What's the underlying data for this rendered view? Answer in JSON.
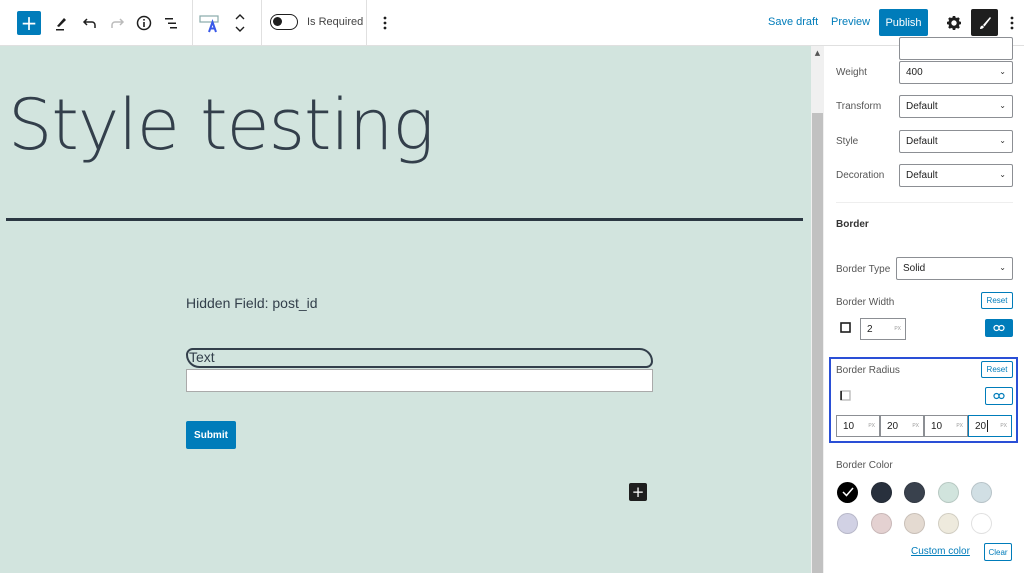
{
  "toolbar": {
    "add_block_icon": "plus-icon",
    "tools_icon": "pencil-icon",
    "undo_icon": "undo-icon",
    "redo_icon": "redo-icon",
    "details_icon": "info-icon",
    "list_view_icon": "list-view-icon",
    "block_type_icon": "text-field-icon",
    "move_icon": "chevron-up-down-icon",
    "required_toggle": {
      "label": "Is Required",
      "checked": false
    },
    "more_icon": "vertical-ellipsis-icon",
    "save_draft_label": "Save draft",
    "preview_label": "Preview",
    "publish_label": "Publish",
    "settings_icon": "gear-icon",
    "styles_icon": "brush-icon",
    "options_icon": "vertical-ellipsis-icon"
  },
  "canvas": {
    "post_title": "Style testing",
    "hidden_field_text": "Hidden Field: post_id",
    "text_field_label": "Text",
    "text_field_value": "",
    "submit_label": "Submit",
    "inserter_icon": "plus-icon"
  },
  "sidebar": {
    "typography": {
      "weight": {
        "label": "Weight",
        "value": "400"
      },
      "transform": {
        "label": "Transform",
        "value": "Default"
      },
      "style": {
        "label": "Style",
        "value": "Default"
      },
      "decoration": {
        "label": "Decoration",
        "value": "Default"
      }
    },
    "border": {
      "heading": "Border",
      "type": {
        "label": "Border Type",
        "value": "Solid"
      },
      "width": {
        "label": "Border Width",
        "reset_label": "Reset",
        "value": "2",
        "unit": "PX",
        "linked": true
      },
      "radius": {
        "label": "Border Radius",
        "reset_label": "Reset",
        "linked": false,
        "values": [
          {
            "value": "10",
            "unit": "PX"
          },
          {
            "value": "20",
            "unit": "PX"
          },
          {
            "value": "10",
            "unit": "PX"
          },
          {
            "value": "20",
            "unit": "PX"
          }
        ]
      },
      "color": {
        "label": "Border Color",
        "swatches": [
          {
            "color": "#000000",
            "selected": true
          },
          {
            "color": "#28303d",
            "selected": false
          },
          {
            "color": "#39414d",
            "selected": false
          },
          {
            "color": "#d1e4dd",
            "selected": false
          },
          {
            "color": "#d1dfe4",
            "selected": false
          },
          {
            "color": "#d1d1e4",
            "selected": false
          },
          {
            "color": "#e4d1d1",
            "selected": false
          },
          {
            "color": "#e4dad1",
            "selected": false
          },
          {
            "color": "#eeeadd",
            "selected": false
          },
          {
            "color": "#ffffff",
            "selected": false
          }
        ],
        "custom_label": "Custom color",
        "clear_label": "Clear"
      }
    }
  },
  "colors": {
    "accent": "#007cba",
    "canvas_bg": "#d2e4de",
    "text_dark": "#333f4b",
    "focus_outline": "#2a4fd6"
  }
}
